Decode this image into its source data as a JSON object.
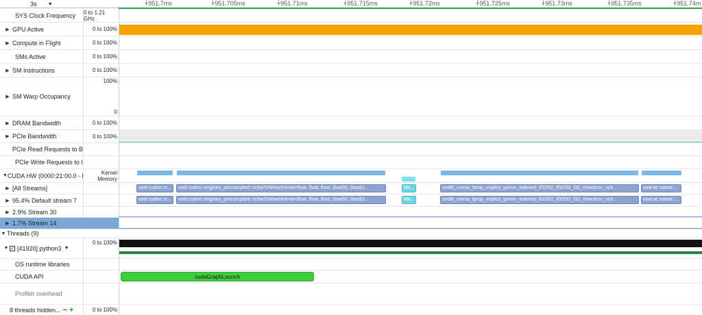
{
  "timeline": {
    "zoom_label": "3s",
    "ticks": [
      "+951.7ms",
      "+951.705ms",
      "+951.71ms",
      "+951.715ms",
      "+951.72ms",
      "+951.725ms",
      "+951.73ms",
      "+951.735ms",
      "+951.74m"
    ]
  },
  "rows": {
    "sys_clock": {
      "label": "SYS Clock Frequency",
      "range": "0 to 1.21 GHz"
    },
    "gpu_active": {
      "label": "GPU Active",
      "range": "0 to 100%"
    },
    "compute_in_flight": {
      "label": "Compute in Flight",
      "range": "0 to 100%"
    },
    "sms_active": {
      "label": "SMs Active",
      "range": "0 to 100%"
    },
    "sm_instructions": {
      "label": "SM Instructions",
      "range": "0 to 100%"
    },
    "sm_warp_occupancy": {
      "label": "SM Warp Occupancy",
      "range_top": "100%",
      "range_bottom": "0"
    },
    "dram_bandwidth": {
      "label": "DRAM Bandwidth",
      "range": "0 to 100%"
    },
    "pcie_bandwidth": {
      "label": "PCIe Bandwidth",
      "range": "0 to 100%"
    },
    "pcie_read": {
      "label": "PCIe Read Requests to B"
    },
    "pcie_write": {
      "label": "PCIe Write Requests to I"
    },
    "cuda_hw": {
      "label": "CUDA HW (0000:21:00.0 - N",
      "sub_kernel": "Kernel",
      "sub_memory": "Memory"
    },
    "all_streams": {
      "label": "[All Streams]"
    },
    "default_stream": {
      "label": "95.4% Default stream 7"
    },
    "stream_30": {
      "label": "2.9% Stream 30"
    },
    "stream_14": {
      "label": "1.7% Stream 14"
    },
    "threads": {
      "label": "Threads (9)"
    },
    "python3": {
      "label": "[41920] python3",
      "range": "0 to 100%"
    },
    "os_runtime": {
      "label": "OS runtime libraries"
    },
    "cuda_api": {
      "label": "CUDA API",
      "call": "cudaGraphLaunch"
    },
    "profiler_overhead": {
      "label": "Profiler overhead"
    },
    "hidden_threads": {
      "label": "8 threads hidden...",
      "range": "0 to 100%"
    }
  },
  "kernels": {
    "k1": "void cudnn::e...",
    "k2": "void cudnn::engines_precompiled::nchwToNhwcKernel<float, float, float, (bool)0, (bool)1...",
    "k3": "Me...",
    "k4": "sm86_xmma_fprop_implicit_gemm_indexed_tf32f32_tf32f32_f32_nhwckrsc_nch...",
    "k5": "void at::native:..."
  },
  "colors": {
    "gpu_active": "#f5a300",
    "kernel_bar": "#7ab8ea",
    "kernel_block": "#8da4d2",
    "memcpy": "#6fd3e3",
    "selected_row": "#7ba7d6",
    "thread_black": "#111111",
    "thread_green": "#1a8a3a",
    "cuda_api_green": "#3fcc3f"
  }
}
